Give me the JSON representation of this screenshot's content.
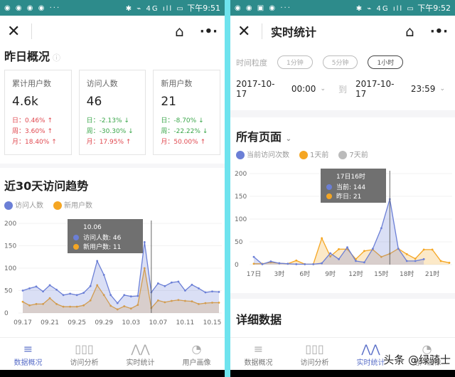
{
  "left": {
    "status": {
      "time": "下午9:51",
      "net": "4G"
    },
    "section_title": "昨日概况",
    "cards": [
      {
        "label": "累计用户数",
        "value": "4.6k",
        "changes": [
          {
            "p": "日：",
            "v": "0.46%",
            "dir": "up",
            "arrow": "↑"
          },
          {
            "p": "周：",
            "v": "3.60%",
            "dir": "up",
            "arrow": "↑"
          },
          {
            "p": "月：",
            "v": "18.40%",
            "dir": "up",
            "arrow": "↑"
          }
        ]
      },
      {
        "label": "访问人数",
        "value": "46",
        "changes": [
          {
            "p": "日：",
            "v": "-2.13%",
            "dir": "down",
            "arrow": "↓"
          },
          {
            "p": "周：",
            "v": "-30.30%",
            "dir": "down",
            "arrow": "↓"
          },
          {
            "p": "月：",
            "v": "17.95%",
            "dir": "up",
            "arrow": "↑"
          }
        ]
      },
      {
        "label": "新用户数",
        "value": "21",
        "changes": [
          {
            "p": "日：",
            "v": "-8.70%",
            "dir": "down",
            "arrow": "↓"
          },
          {
            "p": "周：",
            "v": "-22.22%",
            "dir": "down",
            "arrow": "↓"
          },
          {
            "p": "月：",
            "v": "50.00%",
            "dir": "up",
            "arrow": "↑"
          }
        ]
      }
    ],
    "trend_title": "近30天访问趋势",
    "nav": [
      {
        "label": "数据概况",
        "icon": "≡",
        "active": true
      },
      {
        "label": "访问分析",
        "icon": "▯▯▯",
        "active": false
      },
      {
        "label": "实时统计",
        "icon": "⋀⋀",
        "active": false
      },
      {
        "label": "用户画像",
        "icon": "◔",
        "active": false
      }
    ]
  },
  "right": {
    "status": {
      "time": "下午9:52",
      "net": "4G"
    },
    "title": "实时统计",
    "granularity_label": "时间粒度",
    "granularity": [
      "1分钟",
      "5分钟",
      "1小时"
    ],
    "start_date": "2017-10-17",
    "start_time": "00:00",
    "to": "到",
    "end_date": "2017-10-17",
    "end_time": "23:59",
    "page_select": "所有页面",
    "detail_title": "详细数据",
    "nav": [
      {
        "label": "数据概况",
        "icon": "≡"
      },
      {
        "label": "访问分析",
        "icon": "▯▯▯"
      },
      {
        "label": "实时统计",
        "icon": "⋀⋀"
      },
      {
        "label": "用户画像",
        "icon": "◔"
      }
    ],
    "watermark": "头条 @绿骑士"
  },
  "colors": {
    "blue": "#6b7fd6",
    "orange": "#f5a623",
    "gray": "#bbbbbb",
    "up": "#e0484f",
    "down": "#3aa64a"
  },
  "chart_data": [
    {
      "type": "area",
      "title": "近30天访问趋势",
      "ylim": [
        0,
        200
      ],
      "yticks": [
        0,
        50,
        100,
        150,
        200
      ],
      "x": [
        "09.17",
        "09.18",
        "09.19",
        "09.20",
        "09.21",
        "09.22",
        "09.23",
        "09.24",
        "09.25",
        "09.26",
        "09.27",
        "09.28",
        "09.29",
        "09.30",
        "10.01",
        "10.02",
        "10.03",
        "10.04",
        "10.05",
        "10.06",
        "10.07",
        "10.08",
        "10.09",
        "10.10",
        "10.11",
        "10.12",
        "10.13",
        "10.14",
        "10.15",
        "10.16"
      ],
      "xtick_labels": [
        "09.17",
        "09.21",
        "09.25",
        "09.29",
        "10.03",
        "10.07",
        "10.11",
        "10.15"
      ],
      "series": [
        {
          "name": "访问人数",
          "color": "#6b7fd6",
          "values": [
            50,
            55,
            59,
            48,
            62,
            52,
            40,
            43,
            40,
            45,
            60,
            116,
            85,
            40,
            22,
            40,
            37,
            38,
            158,
            46,
            66,
            60,
            68,
            70,
            50,
            63,
            55,
            46,
            48,
            47
          ]
        },
        {
          "name": "新用户数",
          "color": "#f5a623",
          "values": [
            25,
            17,
            20,
            20,
            33,
            20,
            14,
            14,
            14,
            17,
            28,
            62,
            40,
            16,
            8,
            15,
            10,
            18,
            100,
            11,
            28,
            24,
            27,
            29,
            27,
            26,
            20,
            22,
            23,
            23
          ]
        }
      ],
      "tooltip": {
        "title": "10.06",
        "lines": [
          "访问人数: 46",
          "新用户数: 11"
        ],
        "index": 19
      }
    },
    {
      "type": "area",
      "ylim": [
        0,
        200
      ],
      "yticks": [
        0,
        50,
        100,
        150,
        200
      ],
      "x": [
        0,
        1,
        2,
        3,
        4,
        5,
        6,
        7,
        8,
        9,
        10,
        11,
        12,
        13,
        14,
        15,
        16,
        17,
        18,
        19,
        20,
        21,
        22,
        23
      ],
      "xtick_labels": [
        "17日",
        "3时",
        "6时",
        "9时",
        "12时",
        "15时",
        "18时",
        "21时"
      ],
      "series": [
        {
          "name": "当前访问次数",
          "color": "#6b7fd6",
          "values": [
            17,
            1,
            7,
            3,
            2,
            1,
            1,
            1,
            3,
            25,
            12,
            38,
            8,
            5,
            35,
            80,
            144,
            35,
            8,
            8,
            12
          ]
        },
        {
          "name": "1天前",
          "color": "#f5a623",
          "values": [
            2,
            2,
            5,
            3,
            2,
            9,
            1,
            1,
            58,
            18,
            34,
            34,
            12,
            30,
            33,
            17,
            24,
            35,
            23,
            13,
            33,
            33,
            8,
            4
          ]
        },
        {
          "name": "7天前",
          "color": "#bbbbbb",
          "values": []
        }
      ],
      "tooltip": {
        "title": "17日16时",
        "lines": [
          "当前: 144",
          "昨日: 21"
        ],
        "index": 16
      }
    }
  ]
}
